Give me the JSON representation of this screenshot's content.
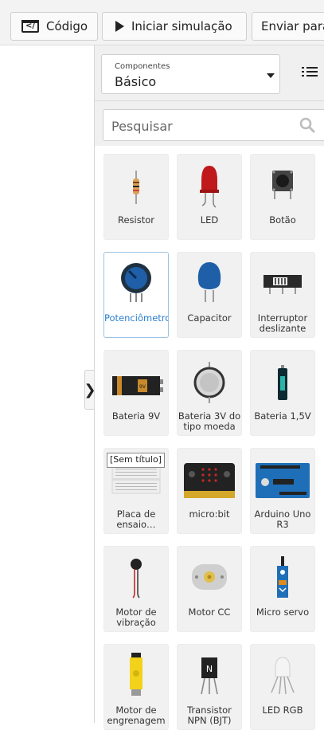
{
  "toolbar": {
    "code_label": "Código",
    "simulate_label": "Iniciar simulação",
    "send_label": "Enviar para"
  },
  "panel": {
    "select_caption": "Componentes",
    "select_value": "Básico",
    "search_placeholder": "Pesquisar",
    "tooltip": "[Sem título]"
  },
  "components": [
    {
      "name": "Resistor",
      "icon": "resistor-icon"
    },
    {
      "name": "LED",
      "icon": "led-icon"
    },
    {
      "name": "Botão",
      "icon": "pushbutton-icon"
    },
    {
      "name": "Potenciômetro",
      "icon": "potentiometer-icon"
    },
    {
      "name": "Capacitor",
      "icon": "capacitor-icon"
    },
    {
      "name": "Interruptor deslizante",
      "icon": "slide-switch-icon"
    },
    {
      "name": "Bateria 9V",
      "icon": "battery-9v-icon"
    },
    {
      "name": "Bateria 3V do tipo moeda",
      "icon": "coin-battery-icon"
    },
    {
      "name": "Bateria 1,5V",
      "icon": "battery-aa-icon"
    },
    {
      "name": "Placa de ensaio…",
      "icon": "breadboard-icon"
    },
    {
      "name": "micro:bit",
      "icon": "microbit-icon"
    },
    {
      "name": "Arduino Uno R3",
      "icon": "arduino-icon"
    },
    {
      "name": "Motor de vibração",
      "icon": "vibration-motor-icon"
    },
    {
      "name": "Motor CC",
      "icon": "dc-motor-icon"
    },
    {
      "name": "Micro servo",
      "icon": "micro-servo-icon"
    },
    {
      "name": "Motor de engrenagem",
      "icon": "gear-motor-icon"
    },
    {
      "name": "Transistor NPN (BJT)",
      "icon": "transistor-icon"
    },
    {
      "name": "LED RGB",
      "icon": "rgb-led-icon"
    }
  ],
  "transistor_marking": "N",
  "colors": {
    "selected": "#2a7fd0",
    "accent_blue": "#1f5fa8"
  }
}
